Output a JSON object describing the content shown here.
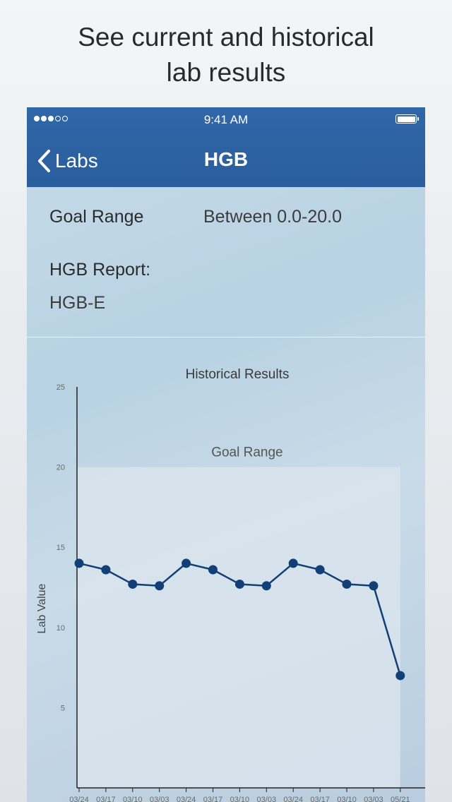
{
  "promo": {
    "line1": "See current and historical",
    "line2": "lab results"
  },
  "status_bar": {
    "time": "9:41 AM",
    "signal_dots": [
      true,
      true,
      true,
      false,
      false
    ]
  },
  "nav": {
    "back_label": "Labs",
    "title": "HGB"
  },
  "info": {
    "goal_range_label": "Goal Range",
    "goal_range_value": "Between 0.0-20.0",
    "report_title": "HGB Report:",
    "report_value": "HGB-E"
  },
  "colors": {
    "nav_bar": "#2c62a3",
    "series": "#123f78",
    "goal_band": "#dce6ee"
  },
  "chart_data": {
    "type": "line",
    "title": "Historical Results",
    "ylabel": "Lab Value",
    "xlabel": "",
    "ylim": [
      0,
      25
    ],
    "yticks": [
      5,
      10,
      15,
      20,
      25
    ],
    "goal_range": {
      "label": "Goal Range",
      "min": 0,
      "max": 20
    },
    "categories": [
      "03/24",
      "03/17",
      "03/10",
      "03/03",
      "03/24",
      "03/17",
      "03/10",
      "03/03",
      "03/24",
      "03/17",
      "03/10",
      "03/03",
      "05/21"
    ],
    "series": [
      {
        "values": [
          14.0,
          13.6,
          12.7,
          12.6,
          14.0,
          13.6,
          12.7,
          12.6,
          14.0,
          13.6,
          12.7,
          12.6,
          7.0
        ]
      }
    ],
    "grid": false,
    "legend": "none"
  }
}
